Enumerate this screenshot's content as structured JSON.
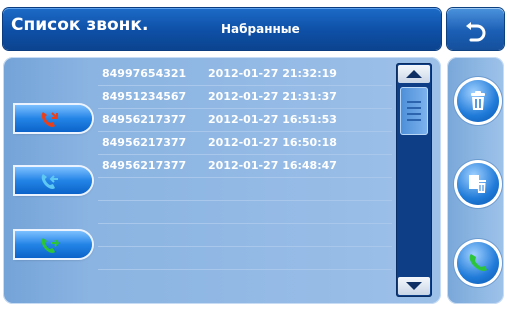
{
  "header": {
    "app_title": "Список звонк.",
    "tab_title": "Набранные"
  },
  "icons": {
    "back": "back-arrow-icon",
    "missed": "missed-call-icon",
    "received": "received-call-icon",
    "dialed": "dialed-call-icon",
    "delete": "trash-icon",
    "delete_all": "delete-all-icon",
    "call": "phone-call-icon"
  },
  "colors": {
    "header": "#0e4fa6",
    "panel": "#8bb4e2",
    "scrollbar": "#0d3e86",
    "missed": "#e8401c",
    "received": "#5ec7f2",
    "dialed": "#2cc43a"
  },
  "calls": [
    {
      "number": "84997654321",
      "datetime": "2012-01-27 21:32:19"
    },
    {
      "number": "84951234567",
      "datetime": "2012-01-27 21:31:37"
    },
    {
      "number": "84956217377",
      "datetime": "2012-01-27 16:51:53"
    },
    {
      "number": "84956217377",
      "datetime": "2012-01-27 16:50:18"
    },
    {
      "number": "84956217377",
      "datetime": "2012-01-27 16:48:47"
    },
    {
      "number": "",
      "datetime": ""
    },
    {
      "number": "",
      "datetime": ""
    },
    {
      "number": "",
      "datetime": ""
    },
    {
      "number": "",
      "datetime": ""
    },
    {
      "number": "",
      "datetime": ""
    }
  ]
}
